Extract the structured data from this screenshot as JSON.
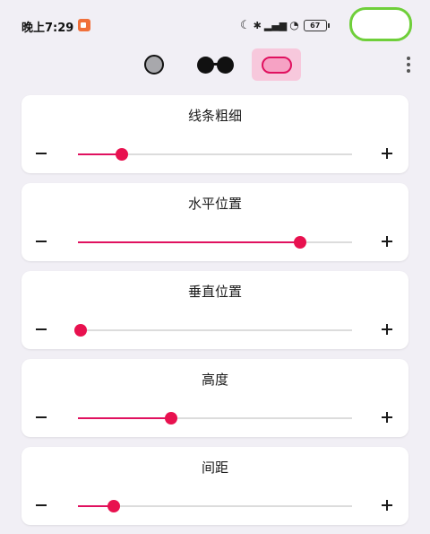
{
  "status_bar": {
    "time": "晚上7:29",
    "battery_label": "67"
  },
  "toolbar": {
    "shapes": [
      "circle",
      "glasses",
      "pill"
    ],
    "selected_shape": "pill"
  },
  "sliders": [
    {
      "title": "线条粗细",
      "value": 0.16
    },
    {
      "title": "水平位置",
      "value": 0.81
    },
    {
      "title": "垂直位置",
      "value": 0.01
    },
    {
      "title": "高度",
      "value": 0.34
    },
    {
      "title": "间距",
      "value": 0.13
    }
  ],
  "colors": {
    "accent": "#e0115f",
    "toggle_border": "#6fcf3a",
    "background": "#f1eff5"
  }
}
